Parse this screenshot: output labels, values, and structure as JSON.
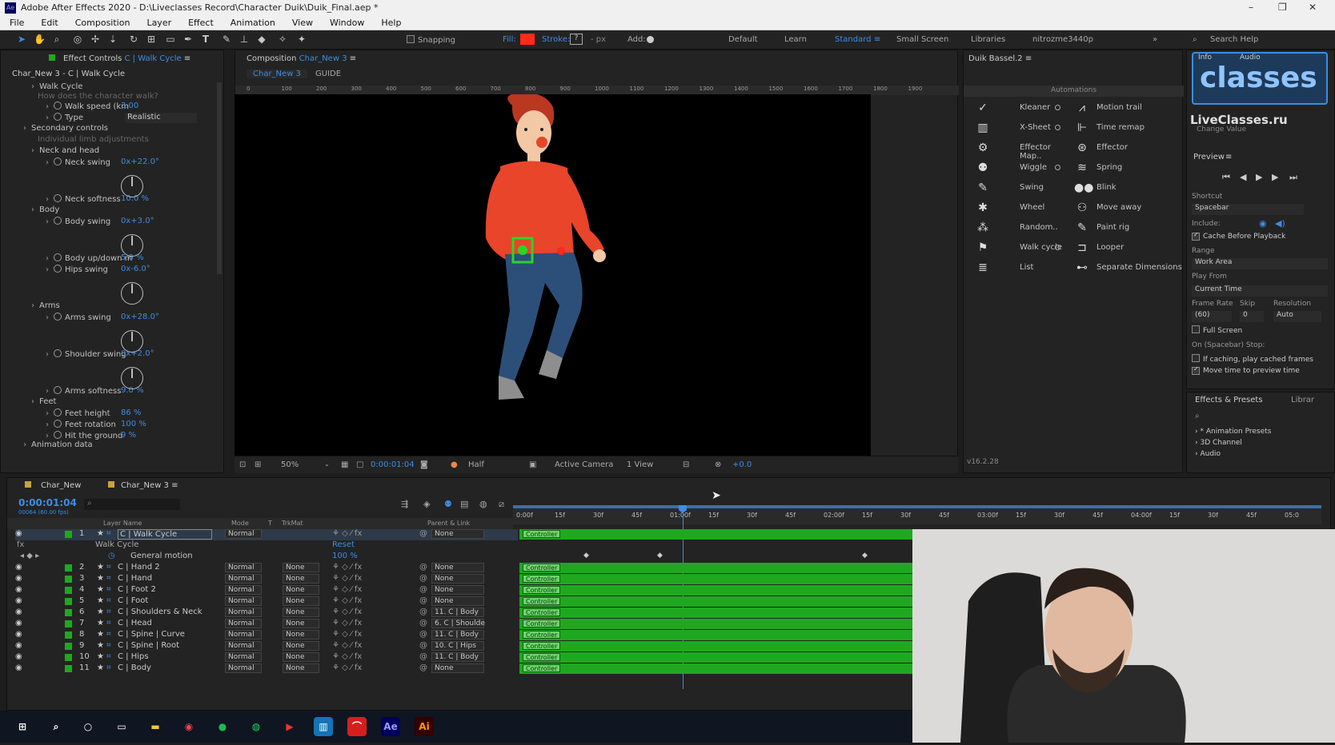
{
  "window": {
    "title": "Adobe After Effects 2020 - D:\\Liveclasses Record\\Character Duik\\Duik_Final.aep *",
    "min": "–",
    "max": "❐",
    "close": "✕"
  },
  "menu": [
    "File",
    "Edit",
    "Composition",
    "Layer",
    "Effect",
    "Animation",
    "View",
    "Window",
    "Help"
  ],
  "toolbar": {
    "snapping": "Snapping",
    "fill": "Fill:",
    "stroke": "Stroke:",
    "stroke_val": "?",
    "px": "- px",
    "add": "Add:",
    "workspaces": [
      "Default",
      "Learn",
      "Standard",
      "Small Screen",
      "Libraries",
      "nitrozme3440p"
    ],
    "search": "Search Help"
  },
  "effect_controls": {
    "tab_prefix": "Effect Controls",
    "tab_layer": "C | Walk Cycle",
    "layer_path": "Char_New 3 - C | Walk Cycle",
    "rows": [
      {
        "label": "Walk Cycle",
        "value": ""
      },
      {
        "label": "How does the character walk?",
        "value": ""
      },
      {
        "label": "Walk speed (km",
        "value": "3.00"
      },
      {
        "label": "Type",
        "value": "Realistic"
      },
      {
        "label": "Secondary controls",
        "value": ""
      },
      {
        "label": "Individual limb adjustments",
        "value": ""
      },
      {
        "label": "Neck and head",
        "value": ""
      },
      {
        "label": "Neck swing",
        "value": "0x+22.0°"
      },
      {
        "label": "Neck softness",
        "value": "10.0 %"
      },
      {
        "label": "Body",
        "value": ""
      },
      {
        "label": "Body swing",
        "value": "0x+3.0°"
      },
      {
        "label": "Body up/down m",
        "value": "5.0 %"
      },
      {
        "label": "Hips swing",
        "value": "0x-6.0°"
      },
      {
        "label": "Arms",
        "value": ""
      },
      {
        "label": "Arms swing",
        "value": "0x+28.0°"
      },
      {
        "label": "Shoulder swing",
        "value": "0x+2.0°"
      },
      {
        "label": "Arms softness",
        "value": "9.0 %"
      },
      {
        "label": "Feet",
        "value": ""
      },
      {
        "label": "Feet height",
        "value": "86 %"
      },
      {
        "label": "Feet rotation",
        "value": "100 %"
      },
      {
        "label": "Hit the ground",
        "value": "9 %"
      },
      {
        "label": "Animation data",
        "value": ""
      }
    ]
  },
  "composition": {
    "tab_prefix": "Composition",
    "tab_name": "Char_New 3",
    "sub_tabs": [
      "Char_New 3",
      "GUIDE"
    ],
    "ruler": [
      "0",
      "100",
      "200",
      "300",
      "400",
      "500",
      "600",
      "700",
      "800",
      "900",
      "1000",
      "1100",
      "1200",
      "1300",
      "1400",
      "1500",
      "1600",
      "1700",
      "1800",
      "1900"
    ],
    "footer": {
      "zoom": "50%",
      "time": "0:00:01:04",
      "res": "Half",
      "camera": "Active Camera",
      "view": "1 View",
      "exposure": "+0.0"
    }
  },
  "duik": {
    "title": "Duik Bassel.2",
    "section": "Automations",
    "version": "v16.2.28",
    "left": [
      "Kleaner",
      "X-Sheet",
      "Effector Map..",
      "Wiggle",
      "Swing",
      "Wheel",
      "Random..",
      "Walk cycle",
      "List"
    ],
    "right": [
      "Motion trail",
      "Time remap",
      "Effector",
      "Spring",
      "Blink",
      "Move away",
      "Paint rig",
      "Looper",
      "Separate Dimensions"
    ]
  },
  "right_panel": {
    "logo": "classes",
    "logo_sub": "LiveClasses.ru",
    "info_tab": "Info",
    "audio_tab": "Audio",
    "change_value": "Change Value",
    "preview": "Preview",
    "shortcut_label": "Shortcut",
    "shortcut": "Spacebar",
    "include": "Include:",
    "cache": "Cache Before Playback",
    "range_label": "Range",
    "range": "Work Area",
    "play_from_label": "Play From",
    "play_from": "Current Time",
    "frame_rate_label": "Frame Rate",
    "skip_label": "Skip",
    "resolution_label": "Resolution",
    "frame_rate": "(60)",
    "skip": "0",
    "resolution": "Auto",
    "full_screen": "Full Screen",
    "on_stop": "On (Spacebar) Stop:",
    "if_caching": "If caching, play cached frames",
    "move_time": "Move time to preview time",
    "effects_tab": "Effects & Presets",
    "libra_tab": "Librar",
    "presets": [
      "* Animation Presets",
      "3D Channel",
      "Audio"
    ]
  },
  "timeline": {
    "tabs": [
      "Char_New",
      "Char_New 3"
    ],
    "time": "0:00:01:04",
    "frames": "00064 (60.00 fps)",
    "headers": {
      "layer_name": "Layer Name",
      "mode": "Mode",
      "t": "T",
      "trkmat": "TrkMat",
      "parent": "Parent & Link"
    },
    "ruler": [
      "0:00f",
      "15f",
      "30f",
      "45f",
      "01:00f",
      "15f",
      "30f",
      "45f",
      "02:00f",
      "15f",
      "30f",
      "45f",
      "03:00f",
      "15f",
      "30f",
      "45f",
      "04:00f",
      "15f",
      "30f",
      "45f",
      "05:0"
    ],
    "layer1": {
      "num": "1",
      "name": "C | Walk Cycle",
      "mode": "Normal",
      "parent": "None"
    },
    "effect_row": {
      "name": "Walk Cycle",
      "reset": "Reset"
    },
    "general": {
      "name": "General motion",
      "value": "100 %"
    },
    "bar_label": "Controller",
    "layers": [
      {
        "num": "2",
        "name": "C | Hand 2",
        "mode": "Normal",
        "trk": "None",
        "parent": "None"
      },
      {
        "num": "3",
        "name": "C | Hand",
        "mode": "Normal",
        "trk": "None",
        "parent": "None"
      },
      {
        "num": "4",
        "name": "C | Foot 2",
        "mode": "Normal",
        "trk": "None",
        "parent": "None"
      },
      {
        "num": "5",
        "name": "C | Foot",
        "mode": "Normal",
        "trk": "None",
        "parent": "None"
      },
      {
        "num": "6",
        "name": "C | Shoulders & Neck",
        "mode": "Normal",
        "trk": "None",
        "parent": "11. C | Body"
      },
      {
        "num": "7",
        "name": "C | Head",
        "mode": "Normal",
        "trk": "None",
        "parent": "6. C | Shoulde"
      },
      {
        "num": "8",
        "name": "C | Spine | Curve",
        "mode": "Normal",
        "trk": "None",
        "parent": "11. C | Body"
      },
      {
        "num": "9",
        "name": "C | Spine | Root",
        "mode": "Normal",
        "trk": "None",
        "parent": "10. C | Hips"
      },
      {
        "num": "10",
        "name": "C | Hips",
        "mode": "Normal",
        "trk": "None",
        "parent": "11. C | Body"
      },
      {
        "num": "11",
        "name": "C | Body",
        "mode": "Normal",
        "trk": "None",
        "parent": "None"
      }
    ]
  },
  "taskbar": {
    "icons": [
      "windows-icon",
      "search-icon",
      "cortana-icon",
      "taskview-icon",
      "explorer-icon",
      "chrome-icon",
      "spotify-icon",
      "whatsapp-icon",
      "media-icon",
      "trello-icon",
      "acrobat-icon",
      "aftereffects-icon",
      "illustrator-icon"
    ],
    "ae": "Ae",
    "ai": "Ai"
  },
  "colors": {
    "accent": "#3d8de3",
    "layer_bar": "#1fa81f",
    "character_shirt": "#e8452a",
    "jeans": "#2c4f7a"
  }
}
